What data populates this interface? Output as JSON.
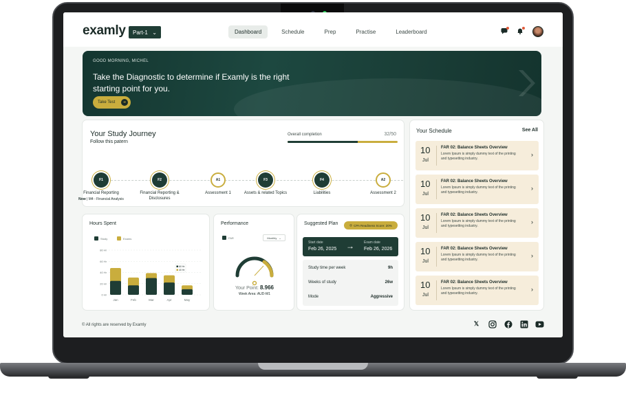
{
  "header": {
    "logo": "examly",
    "part_select": "Part-1",
    "nav": [
      {
        "label": "Dashboard",
        "active": true
      },
      {
        "label": "Schedule",
        "active": false
      },
      {
        "label": "Prep",
        "active": false
      },
      {
        "label": "Practise",
        "active": false
      },
      {
        "label": "Leaderboard",
        "active": false
      }
    ]
  },
  "hero": {
    "greeting": "GOOD MORNING, MICHEL",
    "title": "Take the Diagnostic to determine if Examly is the right starting point for you.",
    "button": "Take Test"
  },
  "journey": {
    "title": "Your Study Journey",
    "subtitle": "Follow this patern",
    "completion_label": "Overall completion",
    "completion_value": "32/50",
    "steps": [
      {
        "code": "F1",
        "label": "Financial Reporting",
        "sub_now": "Now",
        "sub": "M4 - Financial Analysis"
      },
      {
        "code": "F2",
        "label": "Financial Reporting & Disclosures"
      },
      {
        "code": "A1",
        "label": "Assessment 1"
      },
      {
        "code": "F3",
        "label": "Assets & related Topics"
      },
      {
        "code": "F4",
        "label": "Liabilities"
      },
      {
        "code": "A2",
        "label": "Assessment 2"
      }
    ]
  },
  "hours": {
    "title": "Hours Spent",
    "legend": [
      "Study",
      "Exams"
    ],
    "tooltip": [
      "60 Hr",
      "40 Hr"
    ],
    "colors": {
      "study": "#1f3d35",
      "exams": "#c9ad3d"
    }
  },
  "chart_data": {
    "type": "bar",
    "categories": [
      "Jan",
      "Feb",
      "Mar",
      "Apr",
      "May"
    ],
    "series": [
      {
        "name": "Study",
        "values": [
          25,
          17,
          30,
          22,
          10
        ]
      },
      {
        "name": "Exams",
        "values": [
          23,
          14,
          9,
          13,
          7
        ]
      }
    ],
    "y_ticks": [
      "80 Hr",
      "60 Hr",
      "40 Hr",
      "20 Hr",
      "0 Hr"
    ],
    "ylim": [
      0,
      80
    ],
    "stacked": true
  },
  "performance": {
    "title": "Performance",
    "legend": "FAR",
    "filter": "Monthly",
    "point_label": "Your Point:",
    "point_value": "8.966",
    "week_area": "Week Area: AUD-M1"
  },
  "plan": {
    "title": "Suggested Plan",
    "readiness": "CPA Readiness Score: 20%",
    "start_label": "Start date",
    "start_value": "Feb 26, 2025",
    "exam_label": "Exam date",
    "exam_value": "Feb 26, 2026",
    "rows": [
      {
        "label": "Study time per week",
        "value": "9h"
      },
      {
        "label": "Weeks of study",
        "value": "26w"
      },
      {
        "label": "Mode",
        "value": "Aggressive"
      }
    ]
  },
  "schedule": {
    "title": "Your Schedule",
    "see_all": "See All",
    "items": [
      {
        "day": "10",
        "month": "Jul",
        "title": "FAR 02: Balance Sheets Overview",
        "desc": "Lorem Ipsum is simply dummy text of the printing and typesetting industry."
      },
      {
        "day": "10",
        "month": "Jul",
        "title": "FAR 02: Balance Sheets Overview",
        "desc": "Lorem Ipsum is simply dummy text of the printing and typesetting industry."
      },
      {
        "day": "10",
        "month": "Jul",
        "title": "FAR 02: Balance Sheets Overview",
        "desc": "Lorem Ipsum is simply dummy text of the printing and typesetting industry."
      },
      {
        "day": "10",
        "month": "Jul",
        "title": "FAR 02: Balance Sheets Overview",
        "desc": "Lorem Ipsum is simply dummy text of the printing and typesetting industry."
      },
      {
        "day": "10",
        "month": "Jul",
        "title": "FAR 02: Balance Sheets Overview",
        "desc": "Lorem Ipsum is simply dummy text of the printing and typesetting industry."
      }
    ]
  },
  "footer": {
    "copyright": "© All rights are reserved by Examly",
    "social": [
      "x-icon",
      "instagram-icon",
      "facebook-icon",
      "linkedin-icon",
      "youtube-icon"
    ]
  },
  "colors": {
    "accent": "#c9ad3d",
    "brand": "#1f3d35"
  }
}
